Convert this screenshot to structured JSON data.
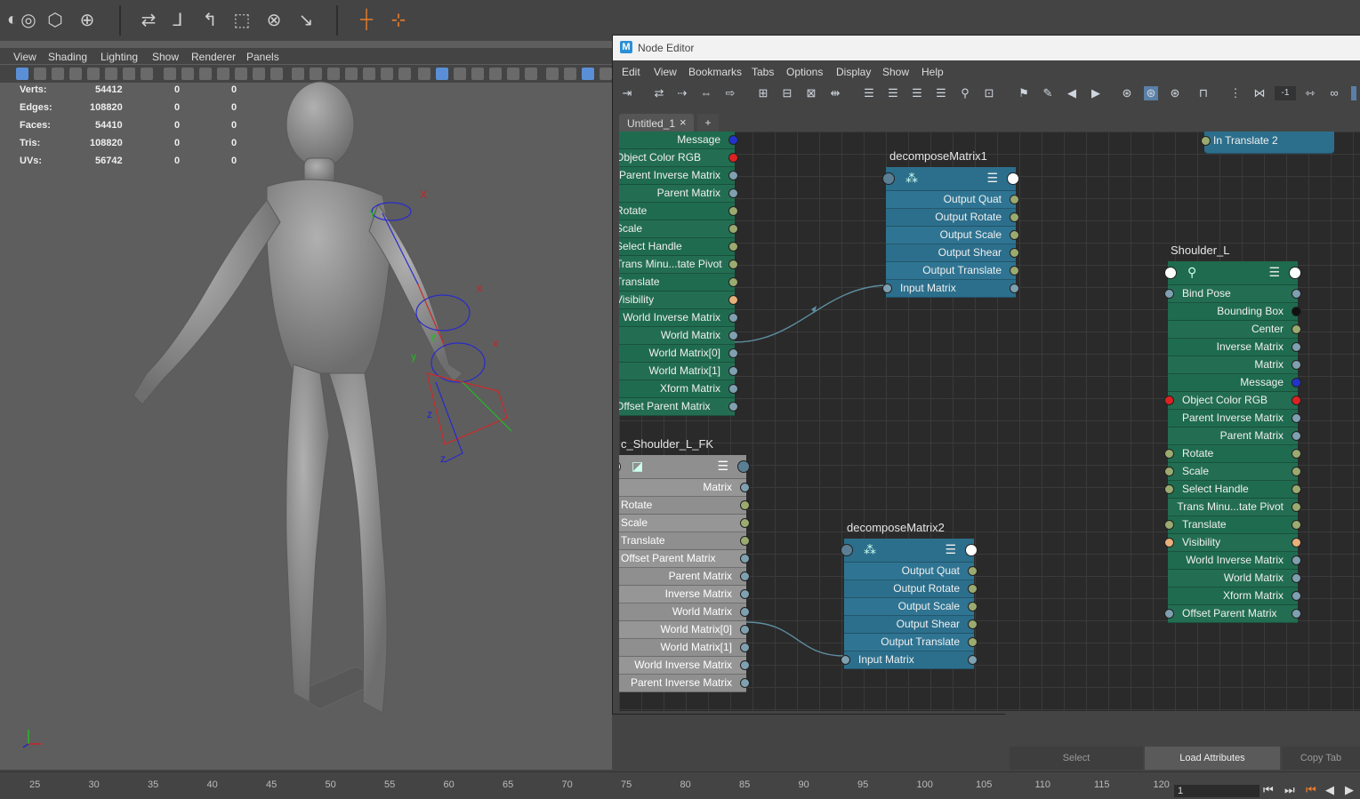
{
  "toolbar": {
    "icons": [
      "sphere-icon",
      "primitives-icon",
      "lattice-icon",
      "transform-icon",
      "snap-icon",
      "joint-icon",
      "ik-icon",
      "bind-icon",
      "paint-icon",
      "mirror-icon",
      "axis-icon",
      "axis-marker-icon"
    ]
  },
  "viewport": {
    "menu": [
      "View",
      "Shading",
      "Lighting",
      "Show",
      "Renderer",
      "Panels"
    ],
    "hud": [
      {
        "label": "Verts:",
        "v1": "54412",
        "v2": "0",
        "v3": "0"
      },
      {
        "label": "Edges:",
        "v1": "108820",
        "v2": "0",
        "v3": "0"
      },
      {
        "label": "Faces:",
        "v1": "54410",
        "v2": "0",
        "v3": "0"
      },
      {
        "label": "Tris:",
        "v1": "108820",
        "v2": "0",
        "v3": "0"
      },
      {
        "label": "UVs:",
        "v1": "56742",
        "v2": "0",
        "v3": "0"
      }
    ],
    "axis_labels": [
      "X",
      "Y",
      "Z",
      "x",
      "y",
      "z"
    ]
  },
  "node_editor": {
    "title": "Node Editor",
    "menu": [
      "Edit",
      "View",
      "Bookmarks",
      "Tabs",
      "Options",
      "Display",
      "Show",
      "Help"
    ],
    "tab": "Untitled_1",
    "tab_close": "×",
    "tab_add": "+",
    "tool_value": "-1",
    "nodes": {
      "left_green": {
        "rows": [
          "Message",
          "Object Color RGB",
          "Parent Inverse Matrix",
          "Parent Matrix",
          "Rotate",
          "Scale",
          "Select Handle",
          "Trans Minu...tate Pivot",
          "Translate",
          "Visibility",
          "World Inverse Matrix",
          "World Matrix",
          "World Matrix[0]",
          "World Matrix[1]",
          "Xform Matrix",
          "Offset Parent Matrix"
        ]
      },
      "decompose1": {
        "title": "decomposeMatrix1",
        "rows": [
          "Output Quat",
          "Output Rotate",
          "Output Scale",
          "Output Shear",
          "Output Translate",
          "Input Matrix"
        ]
      },
      "in_translate": {
        "label": "In Translate 2"
      },
      "shoulder": {
        "title": "Shoulder_L",
        "rows": [
          "Bind Pose",
          "Bounding Box",
          "Center",
          "Inverse Matrix",
          "Matrix",
          "Message",
          "Object Color RGB",
          "Parent Inverse Matrix",
          "Parent Matrix",
          "Rotate",
          "Scale",
          "Select Handle",
          "Trans Minu...tate Pivot",
          "Translate",
          "Visibility",
          "World Inverse Matrix",
          "World Matrix",
          "Xform Matrix",
          "Offset Parent Matrix"
        ]
      },
      "ctrl": {
        "title": "c_Shoulder_L_FK",
        "rows": [
          "Matrix",
          "Rotate",
          "Scale",
          "Translate",
          "Offset Parent Matrix",
          "Parent Matrix",
          "Inverse Matrix",
          "World Matrix",
          "World Matrix[0]",
          "World Matrix[1]",
          "World Inverse Matrix",
          "Parent Inverse Matrix"
        ]
      },
      "decompose2": {
        "title": "decomposeMatrix2",
        "rows": [
          "Output Quat",
          "Output Rotate",
          "Output Scale",
          "Output Shear",
          "Output Translate",
          "Input Matrix"
        ]
      }
    }
  },
  "attribute_editor": {
    "buttons": [
      "Select",
      "Load Attributes",
      "Copy Tab"
    ]
  },
  "timeline": {
    "ticks": [
      "25",
      "30",
      "35",
      "40",
      "45",
      "50",
      "55",
      "60",
      "65",
      "70",
      "75",
      "80",
      "85",
      "90",
      "95",
      "100",
      "105",
      "110",
      "115",
      "120"
    ],
    "current_frame": "1"
  }
}
